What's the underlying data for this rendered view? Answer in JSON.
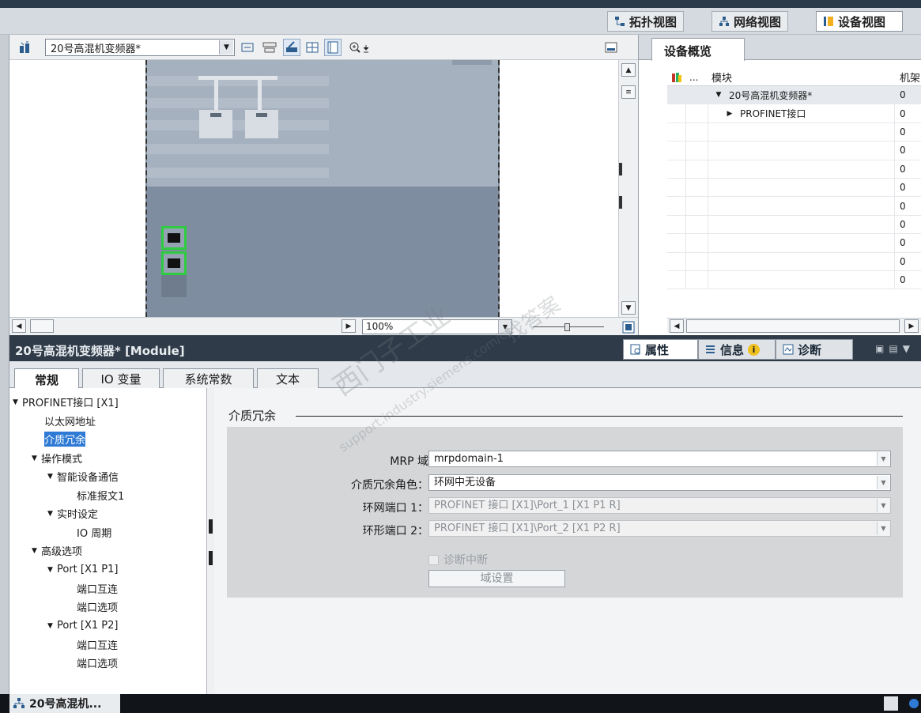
{
  "top": {
    "fragment": ""
  },
  "view_tabs": [
    {
      "label": "拓扑视图"
    },
    {
      "label": "网络视图"
    },
    {
      "label": "设备视图"
    }
  ],
  "toolbar": {
    "device_select": "20号高混机变频器*"
  },
  "canvas": {
    "zoom": "100%"
  },
  "overview": {
    "tab": "设备概览",
    "col_dots": "...",
    "col_module": "模块",
    "col_rack": "机架",
    "rows": [
      {
        "caret": "▼",
        "module": "20号高混机变频器*",
        "rack": "0"
      },
      {
        "caret": "▶",
        "module": "PROFINET接口",
        "rack": "0"
      },
      {
        "caret": "",
        "module": "",
        "rack": "0"
      },
      {
        "caret": "",
        "module": "",
        "rack": "0"
      },
      {
        "caret": "",
        "module": "",
        "rack": "0"
      },
      {
        "caret": "",
        "module": "",
        "rack": "0"
      },
      {
        "caret": "",
        "module": "",
        "rack": "0"
      },
      {
        "caret": "",
        "module": "",
        "rack": "0"
      },
      {
        "caret": "",
        "module": "",
        "rack": "0"
      },
      {
        "caret": "",
        "module": "",
        "rack": "0"
      },
      {
        "caret": "",
        "module": "",
        "rack": "0"
      },
      {
        "caret": "",
        "module": "",
        "rack": ""
      }
    ]
  },
  "props": {
    "title": "20号高混机变频器* [Module]",
    "tabs": [
      "属性",
      "信息",
      "诊断"
    ],
    "subtabs": [
      "常规",
      "IO 变量",
      "系统常数",
      "文本"
    ]
  },
  "tree": [
    "PROFINET接口 [X1]",
    "以太网地址",
    "介质冗余",
    "操作模式",
    "智能设备通信",
    "标准报文1",
    "实时设定",
    "IO 周期",
    "高级选项",
    "Port [X1 P1]",
    "端口互连",
    "端口选项",
    "Port [X1 P2]",
    "端口互连",
    "端口选项"
  ],
  "section": {
    "title": "介质冗余",
    "mrp_label": "MRP 域",
    "mrp_value": "mrpdomain-1",
    "role_label": "介质冗余角色：",
    "role_value": "环网中无设备",
    "port1_label": "环网端口 1：",
    "port1_value": "PROFINET 接口 [X1]\\Port_1 [X1 P1 R]",
    "port2_label": "环形端口 2：",
    "port2_value": "PROFINET 接口 [X1]\\Port_2 [X1 P2 R]",
    "diag_label": "诊断中断",
    "domain_button": "域设置"
  },
  "taskbar": {
    "item": "20号高混机..."
  },
  "watermark": {
    "cn": "西门子工业",
    "site": "support.industry.siemens.com/cs",
    "cn2": "找答案"
  }
}
